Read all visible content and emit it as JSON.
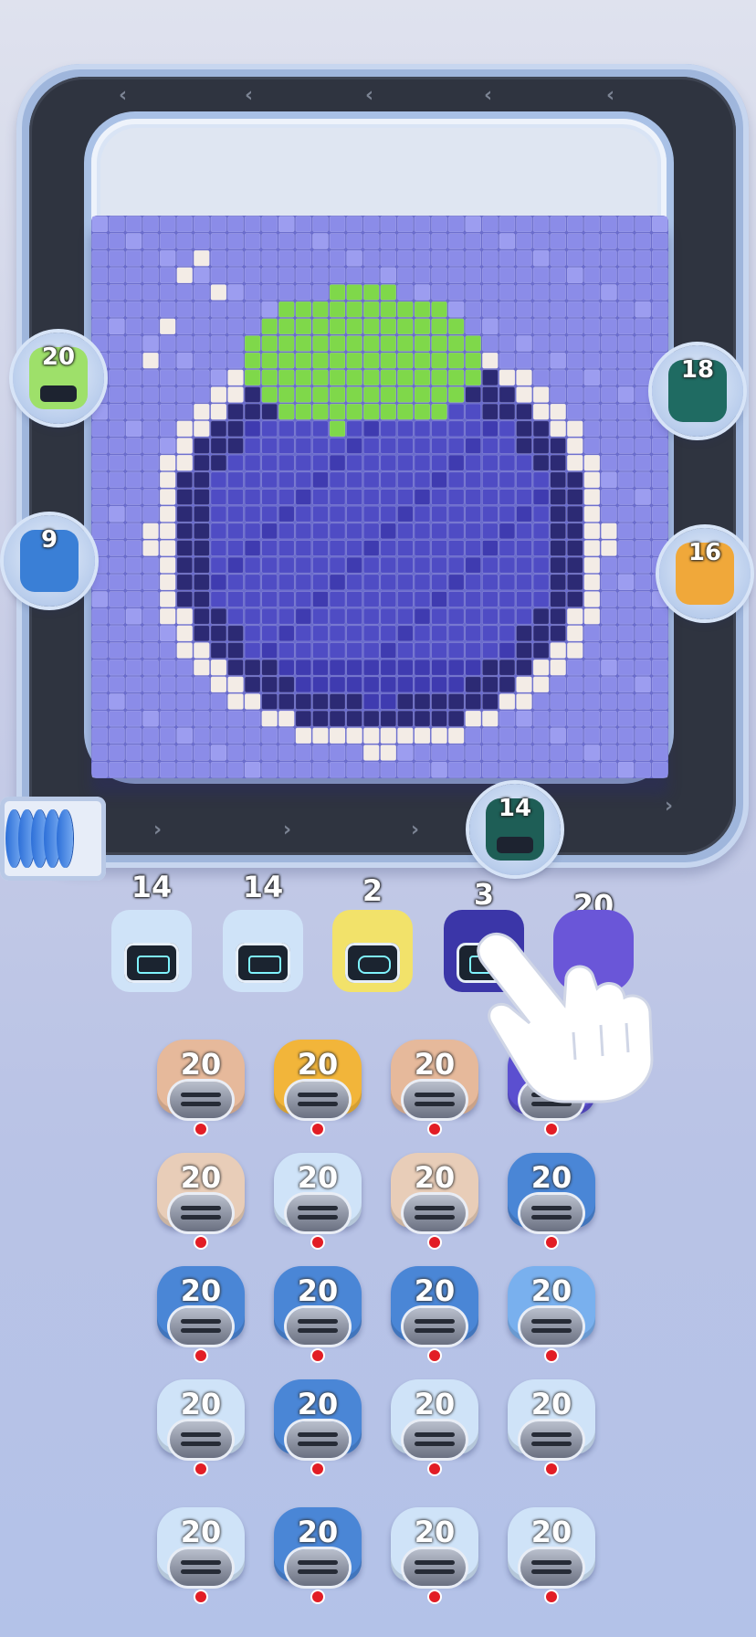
{
  "board": {
    "colors": {
      "bg": "#8b8ce8",
      "light": "#9c9df0",
      "dark": "#2c2a74",
      "mid": "#4f4cc4",
      "deep": "#3f3bb0",
      "green": "#7fd84a",
      "cream": "#f3ece6"
    }
  },
  "side_cars": [
    {
      "count": "20",
      "color": "#9ee06a",
      "icon": "robot-car-icon"
    },
    {
      "count": "9",
      "color": "#3a7fd6",
      "icon": "robot-car-icon"
    },
    {
      "count": "18",
      "color": "#1f6b62",
      "icon": "robot-car-icon"
    },
    {
      "count": "16",
      "color": "#f0a83a",
      "icon": "robot-car-icon"
    },
    {
      "count": "14",
      "color": "#1e5e56",
      "icon": "robot-car-icon"
    }
  ],
  "queue": [
    {
      "count": "14",
      "color": "#cfe3f8",
      "icon": "battery-icon"
    },
    {
      "count": "14",
      "color": "#cfe3f8",
      "icon": "battery-icon"
    },
    {
      "count": "2",
      "color": "#f2e26a",
      "icon": "face-icon"
    },
    {
      "count": "3",
      "color": "#3b36a8",
      "icon": "face-icon"
    },
    {
      "count": "20",
      "color": "#6a56d8",
      "icon": "robot-icon"
    }
  ],
  "grid": [
    [
      {
        "count": "20",
        "color": "#e6b99b"
      },
      {
        "count": "20",
        "color": "#f2b53a"
      },
      {
        "count": "20",
        "color": "#e6b99b"
      },
      {
        "count": "",
        "color": "#5b4fd0"
      }
    ],
    [
      {
        "count": "20",
        "color": "#e8cdb8"
      },
      {
        "count": "20",
        "color": "#cfe3f8"
      },
      {
        "count": "20",
        "color": "#e8cdb8"
      },
      {
        "count": "20",
        "color": "#4a86d6"
      }
    ],
    [
      {
        "count": "20",
        "color": "#4a86d6"
      },
      {
        "count": "20",
        "color": "#4a86d6"
      },
      {
        "count": "20",
        "color": "#4a86d6"
      },
      {
        "count": "20",
        "color": "#79b0ee"
      }
    ],
    [
      {
        "count": "20",
        "color": "#cfe3f8"
      },
      {
        "count": "20",
        "color": "#4a86d6"
      },
      {
        "count": "20",
        "color": "#cfe3f8"
      },
      {
        "count": "20",
        "color": "#cfe3f8"
      }
    ],
    [
      {
        "count": "20",
        "color": "#cfe3f8"
      },
      {
        "count": "20",
        "color": "#4a86d6"
      },
      {
        "count": "20",
        "color": "#cfe3f8"
      },
      {
        "count": "20",
        "color": "#cfe3f8"
      }
    ]
  ],
  "tutorial": {
    "icon": "pointing-hand-icon"
  }
}
